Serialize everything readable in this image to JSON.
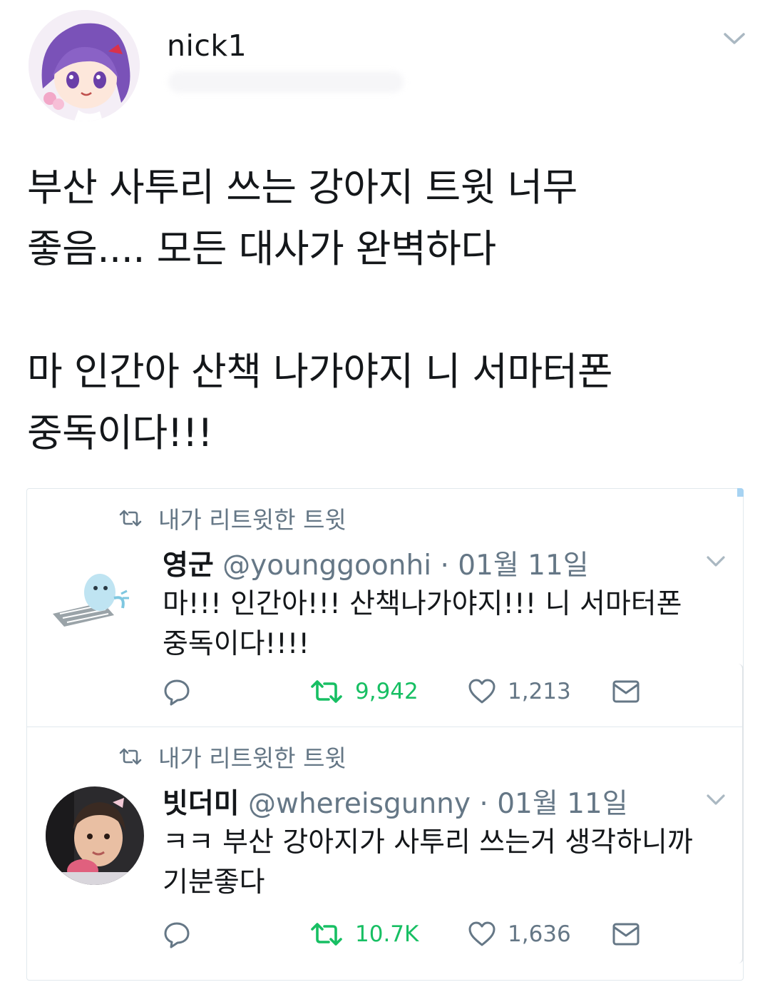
{
  "colors": {
    "text_primary": "#14171a",
    "text_secondary": "#657786",
    "retweet_green": "#17bf63",
    "border": "#e1e8ed"
  },
  "header": {
    "username": "nick1",
    "menu_icon": "chevron-down-icon"
  },
  "tweet": {
    "text": "부산 사투리 쓰는 강아지 트윗 너무\n좋음.... 모든 대사가 완벽하다\n\n마 인간아 산책 나가야지 니 서마터폰\n중독이다!!!"
  },
  "retweets": [
    {
      "context_label": "내가 리트윗한 트윗",
      "display_name": "영군",
      "handle": "@younggoonhi",
      "separator": "·",
      "date": "01월 11일",
      "text": "마!!! 인간아!!! 산책나가야지!!! 니 서마터폰\n중독이다!!!!",
      "retweet_count": "9,942",
      "like_count": "1,213"
    },
    {
      "context_label": "내가 리트윗한 트윗",
      "display_name": "빗더미",
      "handle": "@whereisgunny",
      "separator": "·",
      "date": "01월 11일",
      "text": "ㅋㅋ 부산 강아지가 사투리 쓰는거 생각하니까\n기분좋다",
      "retweet_count": "10.7K",
      "like_count": "1,636"
    }
  ]
}
